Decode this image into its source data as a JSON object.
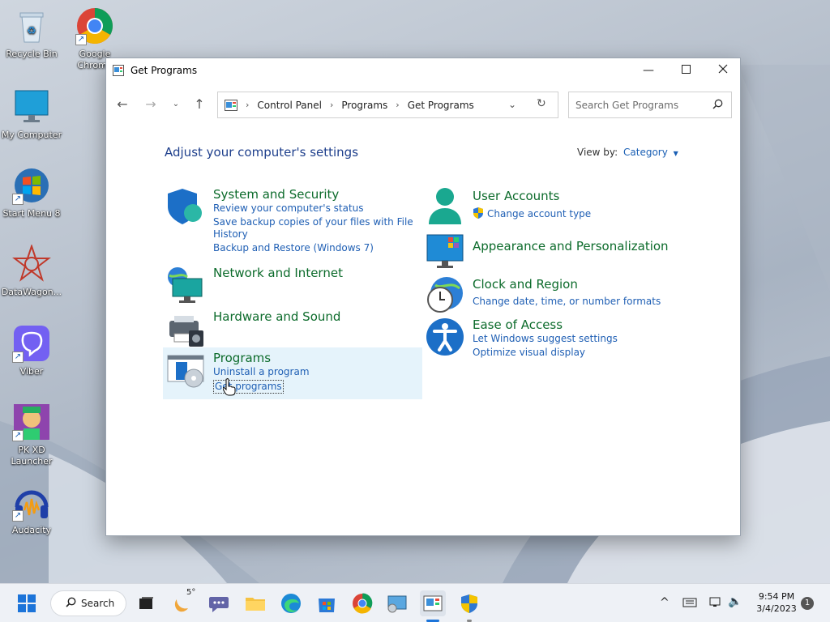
{
  "desktop": {
    "icons": [
      {
        "label": "Recycle Bin"
      },
      {
        "label": "Google Chrome"
      },
      {
        "label": "My Computer"
      },
      {
        "label": "Start Menu 8"
      },
      {
        "label": "DataWagon..."
      },
      {
        "label": "Viber"
      },
      {
        "label": "PK XD Launcher"
      },
      {
        "label": "Audacity"
      }
    ]
  },
  "window": {
    "title": "Get Programs",
    "address": {
      "crumbs": [
        "Control Panel",
        "Programs",
        "Get Programs"
      ]
    },
    "search_placeholder": "Search Get Programs",
    "heading": "Adjust your computer's settings",
    "view_by_label": "View by:",
    "view_by_value": "Category",
    "categories": {
      "system_security": {
        "title": "System and Security",
        "links": [
          "Review your computer's status",
          "Save backup copies of your files with File",
          "History",
          "Backup and Restore (Windows 7)"
        ]
      },
      "network": {
        "title": "Network and Internet"
      },
      "hardware": {
        "title": "Hardware and Sound"
      },
      "programs": {
        "title": "Programs",
        "links": [
          "Uninstall a program",
          "Get programs"
        ]
      },
      "user_accounts": {
        "title": "User Accounts",
        "links": [
          "Change account type"
        ]
      },
      "appearance": {
        "title": "Appearance and Personalization"
      },
      "clock": {
        "title": "Clock and Region",
        "links": [
          "Change date, time, or number formats"
        ]
      },
      "ease": {
        "title": "Ease of Access",
        "links": [
          "Let Windows suggest settings",
          "Optimize visual display"
        ]
      }
    }
  },
  "taskbar": {
    "search_label": "Search",
    "weather_temp": "5°",
    "time": "9:54 PM",
    "date": "3/4/2023",
    "notification_count": "1"
  },
  "colors": {
    "category_title": "#0c6b2b",
    "link": "#1f5fb4",
    "heading": "#1e3f8c"
  }
}
